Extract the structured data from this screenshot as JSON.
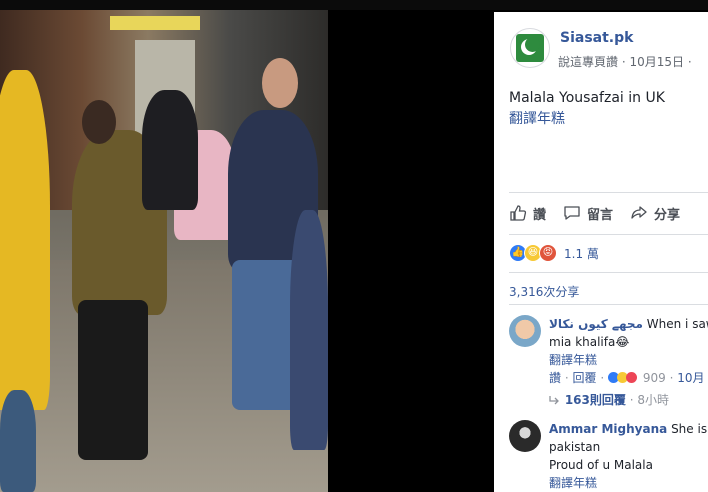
{
  "post": {
    "page_name": "Siasat.pk",
    "meta_prefix": "說這專頁讚",
    "meta_sep": "·",
    "date": "10月15日",
    "meta_suffix": "·",
    "text": "Malala Yousafzai in UK",
    "translate": "翻譯年糕"
  },
  "actions": {
    "like": "讚",
    "comment": "留言",
    "share": "分享"
  },
  "reactions": {
    "count": "1.1 萬",
    "icons": [
      "like-icon",
      "haha-icon",
      "angry-icon"
    ]
  },
  "shares": "3,316次分享",
  "comments": [
    {
      "name": "مجھے کیوں نکالا",
      "text_line1": " When i saw fir",
      "text_line2": "mia khalifa😂",
      "translate": "翻譯年糕",
      "like": "讚",
      "reply": "回覆",
      "count": "909",
      "date": "10月",
      "replies": "163則回覆",
      "replies_time": "8小時"
    },
    {
      "name": "Ammar Mighyana",
      "text_line1": " She is th",
      "text_line2": "pakistan",
      "text_line3": "Proud of u Malala",
      "translate": "翻譯年糕"
    }
  ],
  "colors": {
    "link": "#365899",
    "like_blue": "#2f7bf6",
    "haha_yellow": "#f7c935",
    "angry_red": "#e0553c",
    "love_red": "#ed4556"
  }
}
